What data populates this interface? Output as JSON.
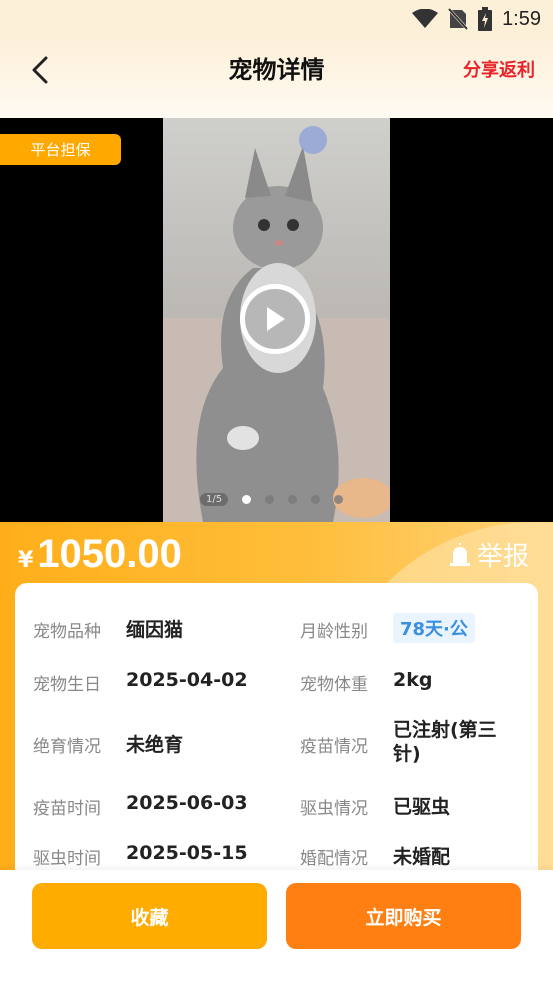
{
  "status_bar": {
    "time": "1:59",
    "icons": [
      "wifi-icon",
      "no-sim-icon",
      "battery-charging-icon"
    ]
  },
  "header": {
    "title": "宠物详情",
    "share_label": "分享返利",
    "back_icon": "chevron-left-icon"
  },
  "media": {
    "badge": "平台担保",
    "page_counter": "1/5",
    "dot_count": 5,
    "active_dot": 0
  },
  "price": {
    "currency": "¥",
    "amount": "1050.00",
    "report_label": "举报"
  },
  "info": {
    "rows": [
      [
        {
          "label": "宠物品种",
          "value": "缅因猫"
        },
        {
          "label": "月龄性别",
          "value": "78天·公"
        }
      ],
      [
        {
          "label": "宠物生日",
          "value": "2025-04-02"
        },
        {
          "label": "宠物体重",
          "value": "2kg"
        }
      ],
      [
        {
          "label": "绝育情况",
          "value": "未绝育"
        },
        {
          "label": "疫苗情况",
          "value": "已注射(第三针)"
        }
      ],
      [
        {
          "label": "疫苗时间",
          "value": "2025-06-03"
        },
        {
          "label": "驱虫情况",
          "value": "已驱虫"
        }
      ],
      [
        {
          "label": "驱虫时间",
          "value": "2025-05-15"
        },
        {
          "label": "婚配情况",
          "value": "未婚配"
        }
      ]
    ]
  },
  "footer": {
    "favorite_label": "收藏",
    "buy_label": "立即购买"
  },
  "colors": {
    "accent_orange": "#ffab00",
    "buy_orange": "#ff7f12",
    "share_red": "#e8232a",
    "tag_blue": "#3a8fe0"
  }
}
